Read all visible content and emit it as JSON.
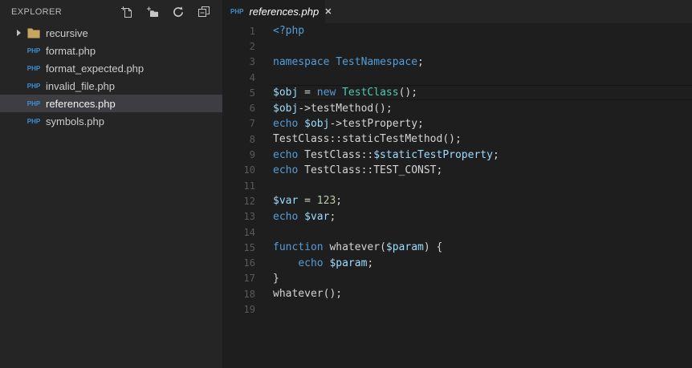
{
  "explorer": {
    "title": "EXPLORER",
    "toolbar_icons": [
      "new-file",
      "new-folder",
      "refresh",
      "collapse-all"
    ],
    "file_badge_text": "PHP",
    "items": [
      {
        "kind": "folder",
        "label": "recursive",
        "collapsed": true,
        "selected": false
      },
      {
        "kind": "php-file",
        "label": "format.php",
        "selected": false
      },
      {
        "kind": "php-file",
        "label": "format_expected.php",
        "selected": false
      },
      {
        "kind": "php-file",
        "label": "invalid_file.php",
        "selected": false
      },
      {
        "kind": "php-file",
        "label": "references.php",
        "selected": true
      },
      {
        "kind": "php-file",
        "label": "symbols.php",
        "selected": false
      }
    ]
  },
  "tab": {
    "label": "references.php",
    "badge": "PHP",
    "close_glyph": "✕",
    "preview_italic": true
  },
  "editor": {
    "language": "php",
    "current_line": 5,
    "lines": [
      {
        "num": 1,
        "tokens": [
          [
            "blue",
            "<?php"
          ]
        ]
      },
      {
        "num": 2,
        "tokens": []
      },
      {
        "num": 3,
        "tokens": [
          [
            "blue",
            "namespace"
          ],
          [
            "fg",
            " "
          ],
          [
            "blue",
            "TestNamespace"
          ],
          [
            "fg",
            ";"
          ]
        ]
      },
      {
        "num": 4,
        "tokens": []
      },
      {
        "num": 5,
        "tokens": [
          [
            "lblue",
            "$obj"
          ],
          [
            "fg",
            " = "
          ],
          [
            "blue",
            "new"
          ],
          [
            "fg",
            " "
          ],
          [
            "cyan",
            "TestClass"
          ],
          [
            "fg",
            "();"
          ]
        ]
      },
      {
        "num": 6,
        "tokens": [
          [
            "lblue",
            "$obj"
          ],
          [
            "fg",
            "->testMethod();"
          ]
        ]
      },
      {
        "num": 7,
        "tokens": [
          [
            "blue",
            "echo"
          ],
          [
            "fg",
            " "
          ],
          [
            "lblue",
            "$obj"
          ],
          [
            "fg",
            "->testProperty;"
          ]
        ]
      },
      {
        "num": 8,
        "tokens": [
          [
            "fg",
            "TestClass::staticTestMethod();"
          ]
        ]
      },
      {
        "num": 9,
        "tokens": [
          [
            "blue",
            "echo"
          ],
          [
            "fg",
            " TestClass::"
          ],
          [
            "lblue",
            "$staticTestProperty"
          ],
          [
            "fg",
            ";"
          ]
        ]
      },
      {
        "num": 10,
        "tokens": [
          [
            "blue",
            "echo"
          ],
          [
            "fg",
            " TestClass::TEST_CONST;"
          ]
        ]
      },
      {
        "num": 11,
        "tokens": []
      },
      {
        "num": 12,
        "tokens": [
          [
            "lblue",
            "$var"
          ],
          [
            "fg",
            " = "
          ],
          [
            "green",
            "123"
          ],
          [
            "fg",
            ";"
          ]
        ]
      },
      {
        "num": 13,
        "tokens": [
          [
            "blue",
            "echo"
          ],
          [
            "fg",
            " "
          ],
          [
            "lblue",
            "$var"
          ],
          [
            "fg",
            ";"
          ]
        ]
      },
      {
        "num": 14,
        "tokens": []
      },
      {
        "num": 15,
        "tokens": [
          [
            "blue",
            "function"
          ],
          [
            "fg",
            " whatever("
          ],
          [
            "lblue",
            "$param"
          ],
          [
            "fg",
            ") {"
          ]
        ]
      },
      {
        "num": 16,
        "tokens": [
          [
            "fg",
            "    "
          ],
          [
            "blue",
            "echo"
          ],
          [
            "fg",
            " "
          ],
          [
            "lblue",
            "$param"
          ],
          [
            "fg",
            ";"
          ]
        ]
      },
      {
        "num": 17,
        "tokens": [
          [
            "fg",
            "}"
          ]
        ]
      },
      {
        "num": 18,
        "tokens": [
          [
            "fg",
            "whatever();"
          ]
        ]
      },
      {
        "num": 19,
        "tokens": []
      }
    ]
  },
  "colors": {
    "editor_bg": "#1E1E1E",
    "sidebar_bg": "#252526",
    "tabbar_bg": "#252526",
    "active_tab_bg": "#1E1E1E",
    "selected_row_bg": "#3E3E42",
    "token_keyword_blue": "#569CD6",
    "token_class_cyan": "#4EC9B0",
    "token_variable_light_blue": "#9CDCFE",
    "token_number_green": "#B5CEA8",
    "token_default_fg": "#D4D4D4",
    "line_number": "#5A5A5A",
    "php_badge_blue": "#3E8FD0",
    "folder_tan": "#C5A55F",
    "current_line_border": "#141414"
  }
}
